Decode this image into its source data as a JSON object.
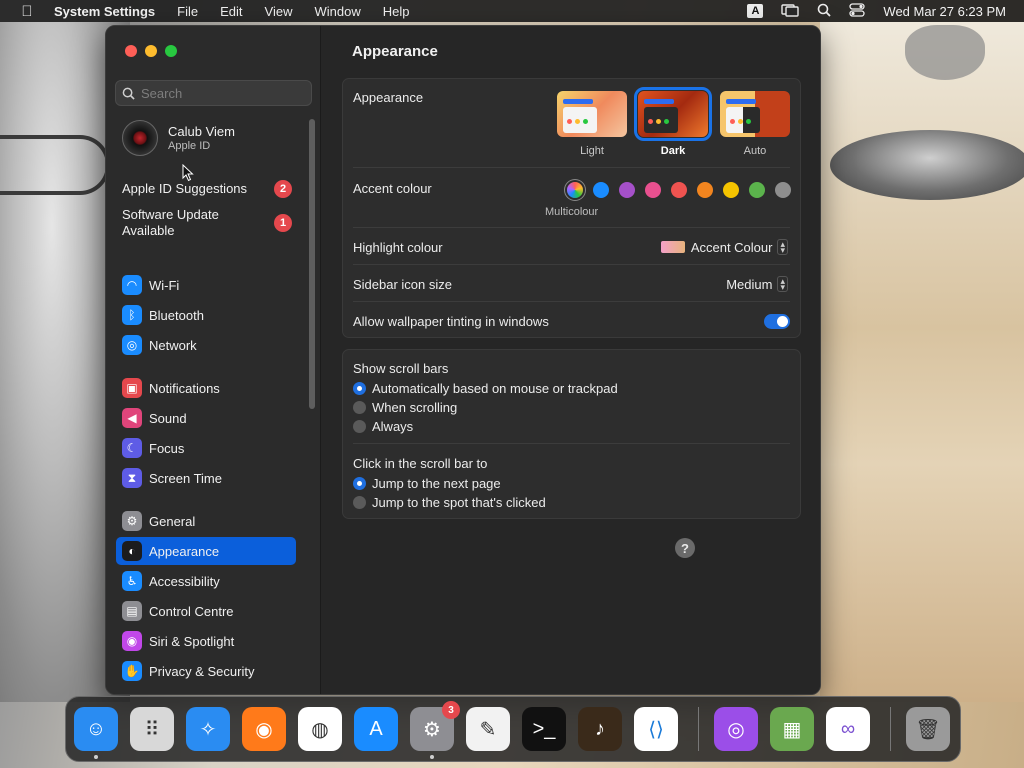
{
  "menubar": {
    "app_name": "System Settings",
    "items": [
      "File",
      "Edit",
      "View",
      "Window",
      "Help"
    ],
    "input_source": "A",
    "clock": "Wed Mar 27  6:23 PM"
  },
  "sidebar": {
    "search_placeholder": "Search",
    "profile": {
      "name": "Calub Viem",
      "subtitle": "Apple ID"
    },
    "notices": [
      {
        "label": "Apple ID Suggestions",
        "badge": "2"
      },
      {
        "label": "Software Update Available",
        "badge": "1"
      }
    ],
    "items": [
      {
        "label": "Wi-Fi",
        "icon": "wifi-icon",
        "color": "#1a8cff"
      },
      {
        "label": "Bluetooth",
        "icon": "bluetooth-icon",
        "color": "#1a8cff"
      },
      {
        "label": "Network",
        "icon": "globe-icon",
        "color": "#1a8cff"
      },
      {
        "label": "Notifications",
        "icon": "bell-icon",
        "color": "#e5484d"
      },
      {
        "label": "Sound",
        "icon": "speaker-icon",
        "color": "#e0457b"
      },
      {
        "label": "Focus",
        "icon": "moon-icon",
        "color": "#5e5ce6"
      },
      {
        "label": "Screen Time",
        "icon": "hourglass-icon",
        "color": "#5e5ce6"
      },
      {
        "label": "General",
        "icon": "gear-icon",
        "color": "#8e8e93"
      },
      {
        "label": "Appearance",
        "icon": "appearance-icon",
        "color": "#1c1c1e"
      },
      {
        "label": "Accessibility",
        "icon": "accessibility-icon",
        "color": "#1a8cff"
      },
      {
        "label": "Control Centre",
        "icon": "control-centre-icon",
        "color": "#8e8e93"
      },
      {
        "label": "Siri & Spotlight",
        "icon": "siri-icon",
        "color": "#c147e9"
      },
      {
        "label": "Privacy & Security",
        "icon": "hand-icon",
        "color": "#1a8cff"
      }
    ],
    "selected": "Appearance"
  },
  "content": {
    "title": "Appearance",
    "appearance": {
      "label": "Appearance",
      "options": [
        "Light",
        "Dark",
        "Auto"
      ],
      "selected": "Dark"
    },
    "accent": {
      "label": "Accent colour",
      "caption": "Multicolour",
      "colors": [
        "#1a8cff",
        "#a550c9",
        "#e8508f",
        "#ef5350",
        "#f2851f",
        "#f5c400",
        "#5bb34c",
        "#8e8e8e"
      ]
    },
    "highlight": {
      "label": "Highlight colour",
      "value": "Accent Colour"
    },
    "sidebar_icon_size": {
      "label": "Sidebar icon size",
      "value": "Medium"
    },
    "wallpaper_tinting": {
      "label": "Allow wallpaper tinting in windows",
      "enabled": true
    },
    "scroll_bars": {
      "label": "Show scroll bars",
      "options": [
        "Automatically based on mouse or trackpad",
        "When scrolling",
        "Always"
      ],
      "selected": 0
    },
    "click_scroll": {
      "label": "Click in the scroll bar to",
      "options": [
        "Jump to the next page",
        "Jump to the spot that's clicked"
      ],
      "selected": 0
    },
    "help": "?"
  },
  "dock": {
    "apps": [
      {
        "name": "finder-icon",
        "color": "#2a8cf2"
      },
      {
        "name": "launchpad-icon",
        "color": "#d8d8d8"
      },
      {
        "name": "safari-icon",
        "color": "#2a8cf2"
      },
      {
        "name": "firefox-icon",
        "color": "#ff7a1a"
      },
      {
        "name": "chrome-icon",
        "color": "#ffffff"
      },
      {
        "name": "app-store-icon",
        "color": "#1a8cff"
      },
      {
        "name": "system-settings-icon",
        "color": "#8e8e93",
        "badge": "3"
      },
      {
        "name": "textedit-icon",
        "color": "#f2f2f2"
      },
      {
        "name": "terminal-icon",
        "color": "#111111"
      },
      {
        "name": "garageband-icon",
        "color": "#3a2a1a"
      },
      {
        "name": "vscode-icon",
        "color": "#ffffff"
      },
      {
        "name": "podcasts-icon",
        "color": "#9b4ee8"
      },
      {
        "name": "minecraft-icon",
        "color": "#6aa84f"
      },
      {
        "name": "visual-studio-icon",
        "color": "#ffffff"
      },
      {
        "name": "trash-icon",
        "color": "#9a9a9a"
      }
    ]
  }
}
